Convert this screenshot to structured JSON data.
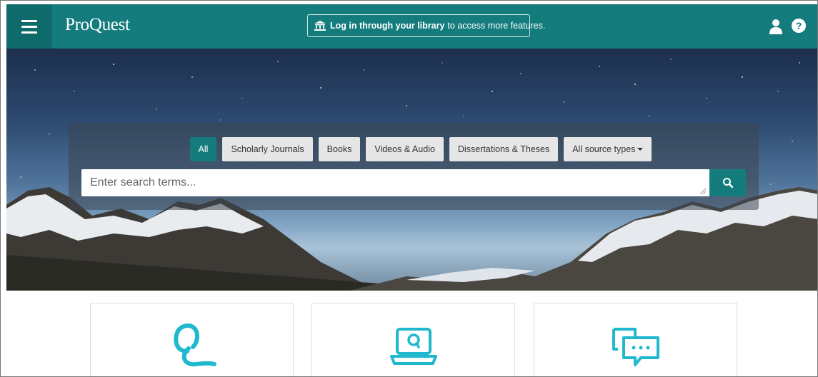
{
  "header": {
    "logo": "ProQuest",
    "login_bold": "Log in through your library",
    "login_rest": "to access more features.",
    "help_glyph": "?"
  },
  "search": {
    "tabs": [
      {
        "label": "All",
        "active": true
      },
      {
        "label": "Scholarly Journals",
        "active": false
      },
      {
        "label": "Books",
        "active": false
      },
      {
        "label": "Videos & Audio",
        "active": false
      },
      {
        "label": "Dissertations & Theses",
        "active": false
      },
      {
        "label": "All source types",
        "active": false
      }
    ],
    "placeholder": "Enter search terms..."
  },
  "cards": [
    {
      "icon": "proquest-q-icon"
    },
    {
      "icon": "laptop-search-icon"
    },
    {
      "icon": "chat-bubbles-icon"
    }
  ],
  "colors": {
    "brand": "#147c7c",
    "brand_dark": "#0f6b6b",
    "accent_cyan": "#1fb8cf"
  }
}
